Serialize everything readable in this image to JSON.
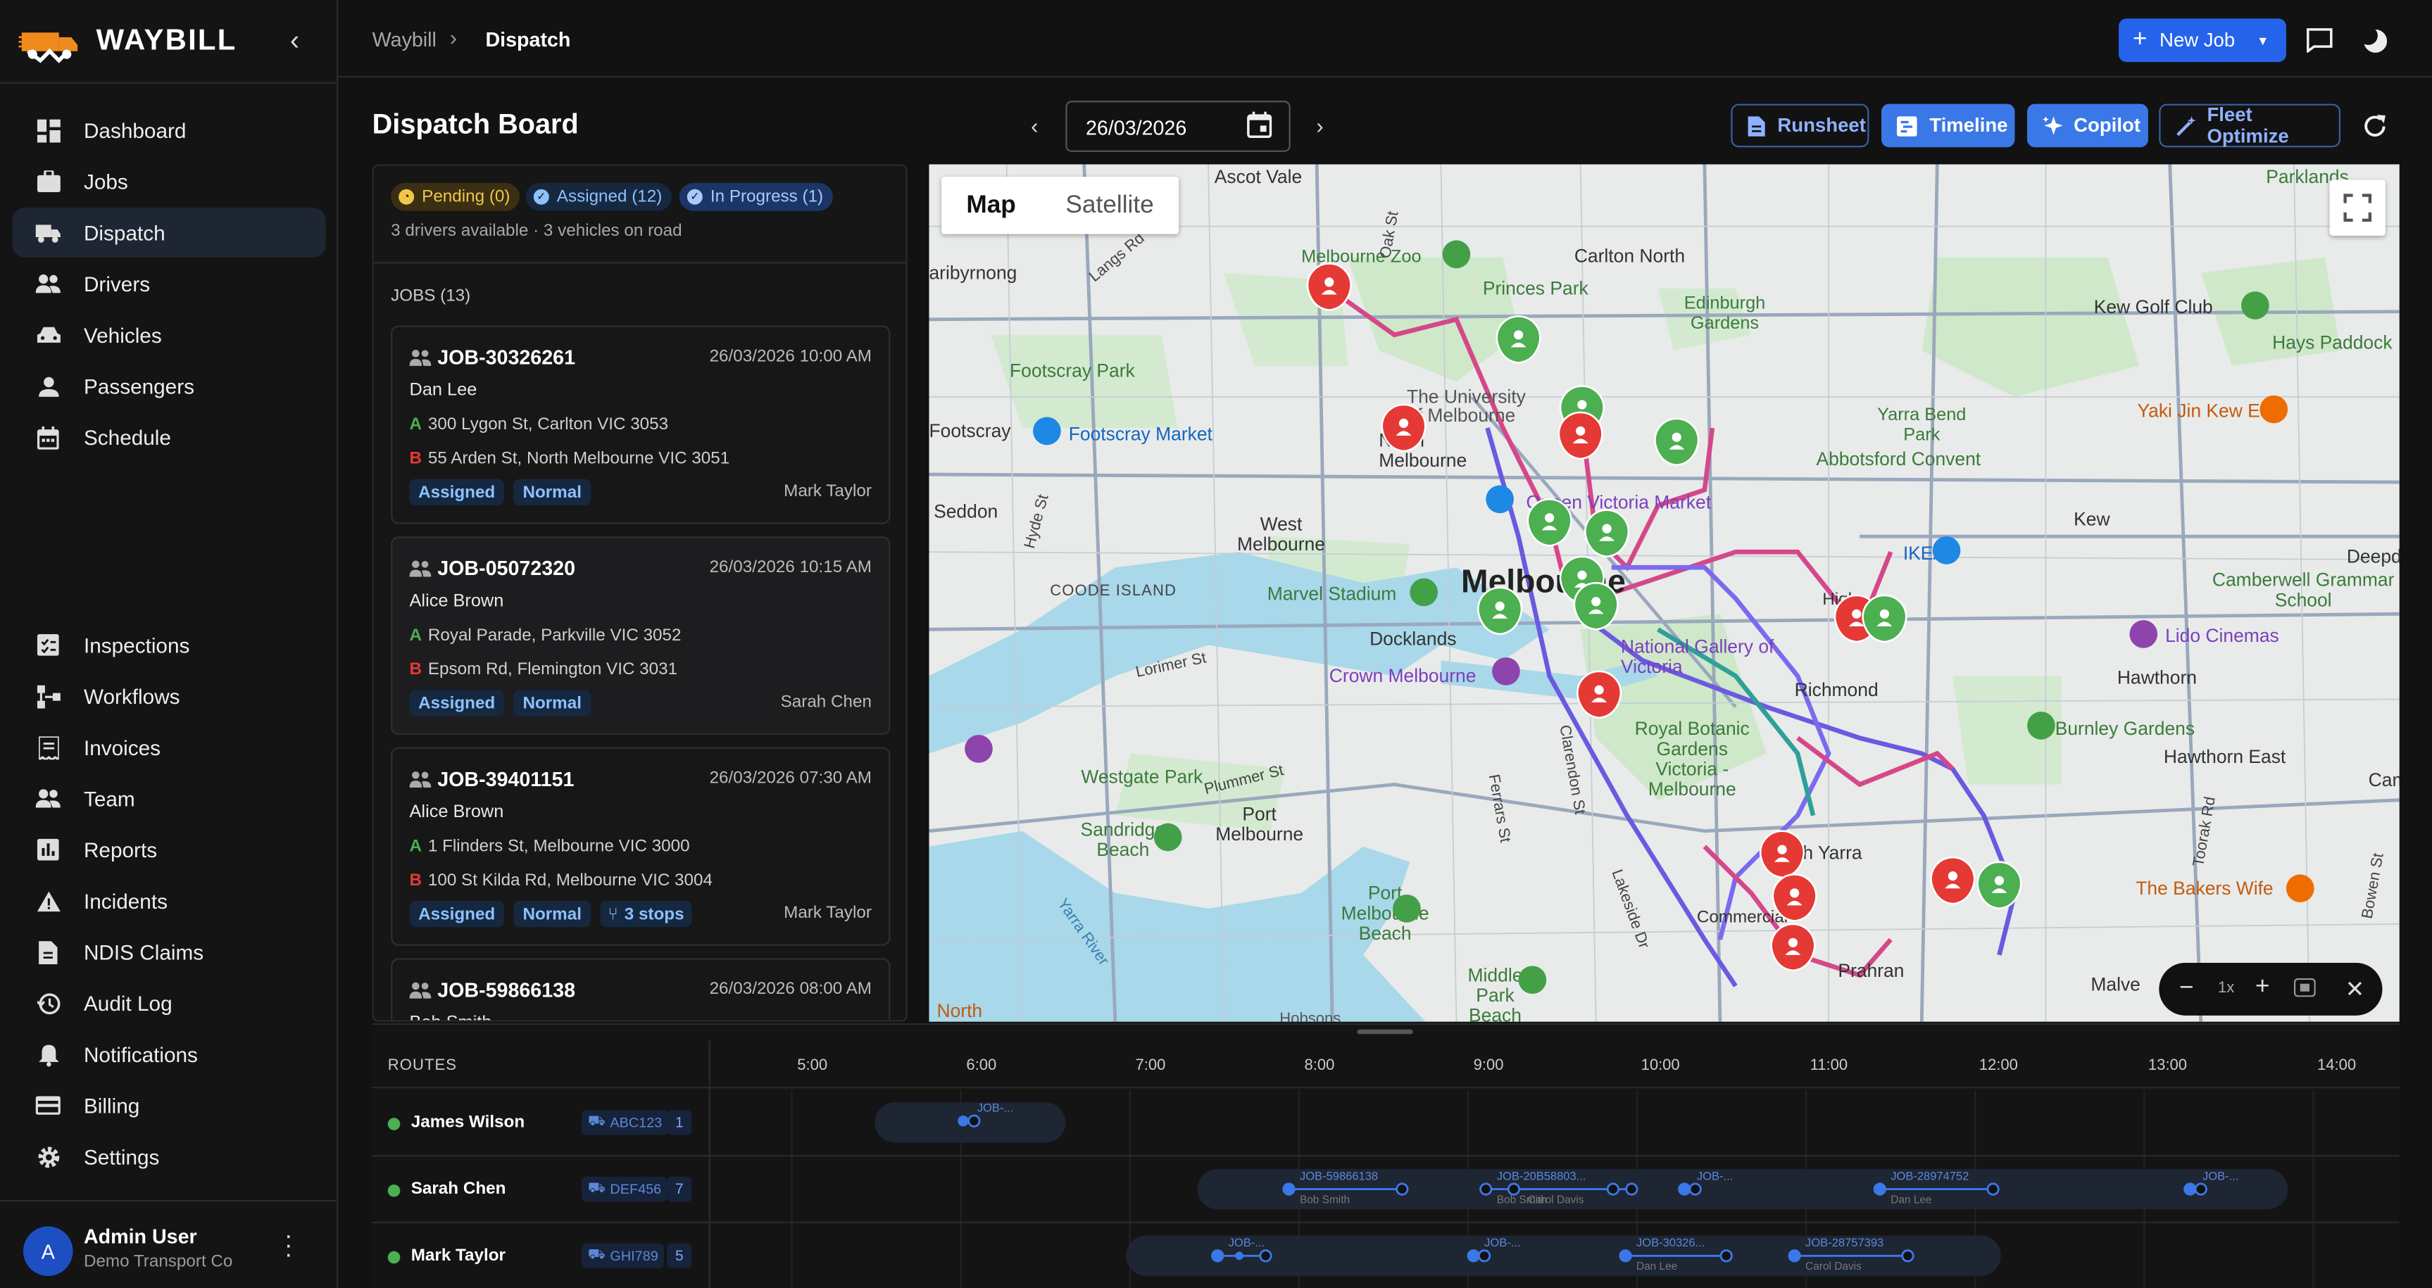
{
  "app": {
    "name": "WAYBILL"
  },
  "sidebar": {
    "items": [
      {
        "label": "Dashboard",
        "icon": "dashboard-icon"
      },
      {
        "label": "Jobs",
        "icon": "briefcase-icon"
      },
      {
        "label": "Dispatch",
        "icon": "truck-icon",
        "active": true
      },
      {
        "label": "Drivers",
        "icon": "people-icon"
      },
      {
        "label": "Vehicles",
        "icon": "car-icon"
      },
      {
        "label": "Passengers",
        "icon": "person-icon"
      },
      {
        "label": "Schedule",
        "icon": "calendar-icon"
      },
      {
        "label": "Inspections",
        "icon": "checklist-icon"
      },
      {
        "label": "Workflows",
        "icon": "workflow-icon"
      },
      {
        "label": "Invoices",
        "icon": "invoice-icon"
      },
      {
        "label": "Team",
        "icon": "team-icon"
      },
      {
        "label": "Reports",
        "icon": "chart-icon"
      },
      {
        "label": "Incidents",
        "icon": "warning-icon"
      },
      {
        "label": "NDIS Claims",
        "icon": "document-icon"
      },
      {
        "label": "Audit Log",
        "icon": "history-icon"
      },
      {
        "label": "Notifications",
        "icon": "bell-icon"
      },
      {
        "label": "Billing",
        "icon": "credit-card-icon"
      },
      {
        "label": "Settings",
        "icon": "gear-icon"
      }
    ],
    "user": {
      "initial": "A",
      "name": "Admin User",
      "org": "Demo Transport Co"
    }
  },
  "topbar": {
    "breadcrumb": [
      "Waybill",
      "Dispatch"
    ],
    "new_job_label": "New Job"
  },
  "board": {
    "title": "Dispatch Board",
    "date": "26/03/2026",
    "buttons": {
      "runsheet": "Runsheet",
      "timeline": "Timeline",
      "copilot": "Copilot",
      "fleet": "Fleet Optimize"
    }
  },
  "jobs_panel": {
    "chips": {
      "pending": "Pending (0)",
      "assigned": "Assigned (12)",
      "in_progress": "In Progress (1)"
    },
    "summary": "3 drivers available · 3 vehicles on road",
    "jobs_header": "JOBS (13)",
    "jobs": [
      {
        "id": "JOB-30326261",
        "date": "26/03/2026 10:00 AM",
        "passenger": "Dan Lee",
        "from": "300 Lygon St, Carlton VIC 3053",
        "to": "55 Arden St, North Melbourne VIC 3051",
        "status": "Assigned",
        "priority": "Normal",
        "stops": "",
        "driver": "Mark Taylor"
      },
      {
        "id": "JOB-05072320",
        "date": "26/03/2026 10:15 AM",
        "passenger": "Alice Brown",
        "from": "Royal Parade, Parkville VIC 3052",
        "to": "Epsom Rd, Flemington VIC 3031",
        "status": "Assigned",
        "priority": "Normal",
        "stops": "",
        "driver": "Sarah Chen"
      },
      {
        "id": "JOB-39401151",
        "date": "26/03/2026 07:30 AM",
        "passenger": "Alice Brown",
        "from": "1 Flinders St, Melbourne VIC 3000",
        "to": "100 St Kilda Rd, Melbourne VIC 3004",
        "status": "Assigned",
        "priority": "Normal",
        "stops": "3 stops",
        "driver": "Mark Taylor"
      },
      {
        "id": "JOB-59866138",
        "date": "26/03/2026 08:00 AM",
        "passenger": "Bob Smith"
      }
    ],
    "point_a": "A",
    "point_b": "B"
  },
  "map": {
    "toggle": {
      "map": "Map",
      "satellite": "Satellite"
    },
    "zoom_label": "1x",
    "labels": {
      "ascot_vale": "Ascot Vale",
      "parklands": "Parklands",
      "carlton_north": "Carlton North",
      "melbourne_zoo": "Melbourne Zoo",
      "princes_park": "Princes Park",
      "maribyrnong": "aribyrnong",
      "kew_golf": "Kew Golf Club",
      "edinburgh": "Edinburgh Gardens",
      "hays": "Hays Paddock",
      "footscray_park": "Footscray Park",
      "the_university": "The University of Melbourne",
      "yarra_bend": "Yarra Bend Park",
      "yaki": "Yaki Jin Kew East",
      "footscray": "Footscray",
      "footscray_market": "Footscray Market",
      "north_melbourne": "North Melbourne",
      "abbotsford": "Abbotsford Convent",
      "seddon": "Seddon",
      "queen_vic": "Queen Victoria Market",
      "kew": "Kew",
      "west_melbourne": "West Melbourne",
      "ikea": "IKEA",
      "deepdene": "Deepd",
      "coode": "COODE ISLAND",
      "marvel": "Marvel Stadium",
      "melbourne": "Melbourne",
      "camberwell": "Camberwell Grammar School",
      "docklands": "Docklands",
      "ngv": "National Gallery of Victoria",
      "lido": "Lido Cinemas",
      "crown": "Crown Melbourne",
      "richmond": "Richmond",
      "hawthorn": "Hawthorn",
      "royal_botanic": "Royal Botanic Gardens Victoria - Melbourne",
      "burnley": "Burnley Gardens",
      "hawthorn_east": "Hawthorn East",
      "westgate": "Westgate Park",
      "port_melbourne": "Port Melbourne",
      "sandridge": "Sandridge Beach",
      "south_yarra": "th Yarra",
      "the_bakers": "The Bakers Wife",
      "port_beach": "Port Melbourne Beach",
      "commercial": "Commercial",
      "middle_park": "Middle Park Beach",
      "prahran": "Prahran",
      "malvern": "Malve",
      "north": "North",
      "hobsons": "Hobsons",
      "lorimer": "Lorimer St",
      "plummer": "Plummer St",
      "yarra_river": "Yarra River",
      "ferrars": "Ferrars St",
      "clarendon": "Clarendon St",
      "lakeside": "Lakeside Dr",
      "toorak": "Toorak Rd",
      "bowen": "Bowen St",
      "high": "High",
      "hyde": "Hyde St",
      "langs": "Langs Rd",
      "oak": "Oak St",
      "yarra_bank": "Yarra Bend",
      "cam": "Cam"
    }
  },
  "timeline": {
    "routes_label": "ROUTES",
    "ticks": [
      "5:00",
      "6:00",
      "7:00",
      "8:00",
      "9:00",
      "10:00",
      "11:00",
      "12:00",
      "13:00",
      "14:00"
    ],
    "routes": [
      {
        "driver": "James Wilson",
        "vehicle": "ABC123",
        "count": "1",
        "segments": [
          {
            "label": "JOB-...",
            "sub": ""
          }
        ]
      },
      {
        "driver": "Sarah Chen",
        "vehicle": "DEF456",
        "count": "7",
        "segments": [
          {
            "label": "JOB-59866138",
            "sub": "Bob Smith"
          },
          {
            "label": "JOB-20B58803...",
            "sub": "Bob Smith"
          },
          {
            "label": "JOB-...",
            "sub": "Carol Davis"
          },
          {
            "label": "JOB-...",
            "sub": ""
          },
          {
            "label": "JOB-28974752",
            "sub": "Dan Lee"
          },
          {
            "label": "JOB-...",
            "sub": ""
          }
        ]
      },
      {
        "driver": "Mark Taylor",
        "vehicle": "GHI789",
        "count": "5",
        "segments": [
          {
            "label": "JOB-...",
            "sub": ""
          },
          {
            "label": "JOB-...",
            "sub": ""
          },
          {
            "label": "JOB-30326...",
            "sub": "Dan Lee"
          },
          {
            "label": "JOB-28757393",
            "sub": "Carol Davis"
          }
        ]
      }
    ]
  },
  "colors": {
    "accent": "#2563eb",
    "assigned_pin": "#4caf50",
    "pending_pin": "#e53935",
    "route_pink": "#d6478a",
    "route_purple": "#6a5ae0"
  }
}
